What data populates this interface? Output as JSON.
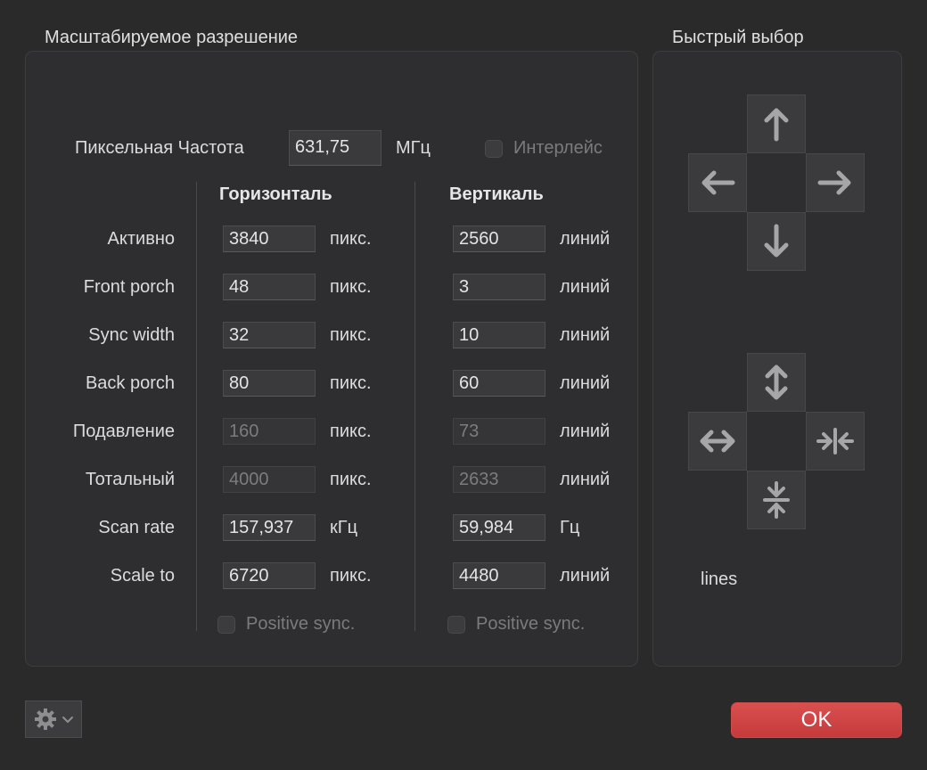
{
  "sections": {
    "scaled_resolution_title": "Масштабируемое разрешение",
    "quick_select_title": "Быстрый выбор"
  },
  "pixel_clock": {
    "label": "Пиксельная Частота",
    "value": "631,75",
    "unit": "МГц"
  },
  "interlace": {
    "label": "Интерлейс",
    "checked": false
  },
  "columns": {
    "horizontal": "Горизонталь",
    "vertical": "Вертикаль"
  },
  "rows": [
    {
      "label": "Активно",
      "h": "3840",
      "h_unit": "пикс.",
      "v": "2560",
      "v_unit": "линий",
      "disabled": false
    },
    {
      "label": "Front porch",
      "h": "48",
      "h_unit": "пикс.",
      "v": "3",
      "v_unit": "линий",
      "disabled": false
    },
    {
      "label": "Sync width",
      "h": "32",
      "h_unit": "пикс.",
      "v": "10",
      "v_unit": "линий",
      "disabled": false
    },
    {
      "label": "Back porch",
      "h": "80",
      "h_unit": "пикс.",
      "v": "60",
      "v_unit": "линий",
      "disabled": false
    },
    {
      "label": "Подавление",
      "h": "160",
      "h_unit": "пикс.",
      "v": "73",
      "v_unit": "линий",
      "disabled": true
    },
    {
      "label": "Тотальный",
      "h": "4000",
      "h_unit": "пикс.",
      "v": "2633",
      "v_unit": "линий",
      "disabled": true
    },
    {
      "label": "Scan rate",
      "h": "157,937",
      "h_unit": "кГц",
      "v": "59,984",
      "v_unit": "Гц",
      "disabled": false
    },
    {
      "label": "Scale to",
      "h": "6720",
      "h_unit": "пикс.",
      "v": "4480",
      "v_unit": "линий",
      "disabled": false
    }
  ],
  "positive_sync": {
    "h_label": "Positive sync.",
    "v_label": "Positive sync.",
    "h_checked": false,
    "v_checked": false
  },
  "quick_select": {
    "move_icons": [
      "arrow-up-icon",
      "arrow-left-icon",
      "arrow-right-icon",
      "arrow-down-icon"
    ],
    "resize_icons": [
      "expand-vertical-icon",
      "expand-horizontal-icon",
      "compress-horizontal-icon",
      "compress-vertical-icon"
    ],
    "status_text": "lines"
  },
  "footer": {
    "ok_label": "OK",
    "settings_icon": "gear-icon"
  },
  "colors": {
    "background": "#2a2a2b",
    "panel": "#2e2e30",
    "ok_button": "#d04445",
    "field": "#3a3a3c"
  }
}
